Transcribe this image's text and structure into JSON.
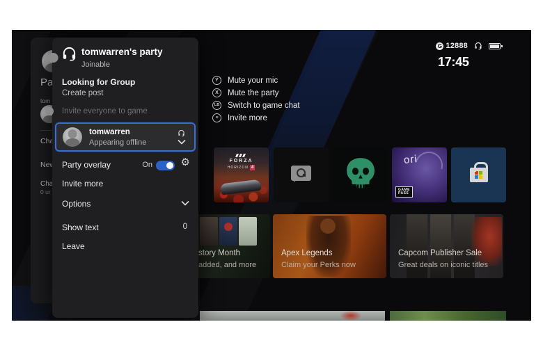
{
  "status_bar": {
    "gamerscore": "12888",
    "gamerscore_icon": "G",
    "time": "17:45"
  },
  "party_flyout": {
    "title": "tomwarren's party",
    "subtitle": "Joinable",
    "lfg_title": "Looking for Group",
    "lfg_subtitle": "Create post",
    "invite_everyone": "Invite everyone to game",
    "member": {
      "name": "tomwarren",
      "status": "Appearing offline"
    },
    "party_overlay_label": "Party overlay",
    "party_overlay_state": "On",
    "invite_more": "Invite more",
    "options": "Options",
    "show_text_label": "Show text",
    "show_text_value": "0",
    "leave": "Leave"
  },
  "guide_panel_fragments": {
    "f1": "Par",
    "f2": "tom",
    "f3": "Cha",
    "f4": "New",
    "f5": "Cha",
    "f6": "0 ur"
  },
  "shortcuts": [
    {
      "button": "Y",
      "label": "Mute your mic"
    },
    {
      "button": "X",
      "label": "Mute the party"
    },
    {
      "button": "LB",
      "label": "Switch to game chat"
    },
    {
      "button": "≡",
      "label": "Invite more"
    }
  ],
  "tiles": [
    {
      "name": "forza-horizon-4",
      "logo_word": "FORZA",
      "logo_sub": "HORIZON",
      "logo_badge": "4"
    },
    {
      "name": "chat-message"
    },
    {
      "name": "sea-of-thieves"
    },
    {
      "name": "ori",
      "logo": "ori",
      "badge_line1": "GAME",
      "badge_line2": "PASS"
    },
    {
      "name": "microsoft-store"
    }
  ],
  "banners": [
    {
      "title": "story Month",
      "subtitle": "added, and more"
    },
    {
      "title": "Apex Legends",
      "subtitle": "Claim your Perks now"
    },
    {
      "title": "Capcom Publisher Sale",
      "subtitle": "Great deals on iconic titles"
    }
  ],
  "colors": {
    "accent_blue": "#3f6ec9",
    "toggle_on": "#2a62c5",
    "panel": "#1f1f21",
    "screen_bg": "#0a0a0c",
    "sea_of_thieves_green": "#2f9068"
  }
}
